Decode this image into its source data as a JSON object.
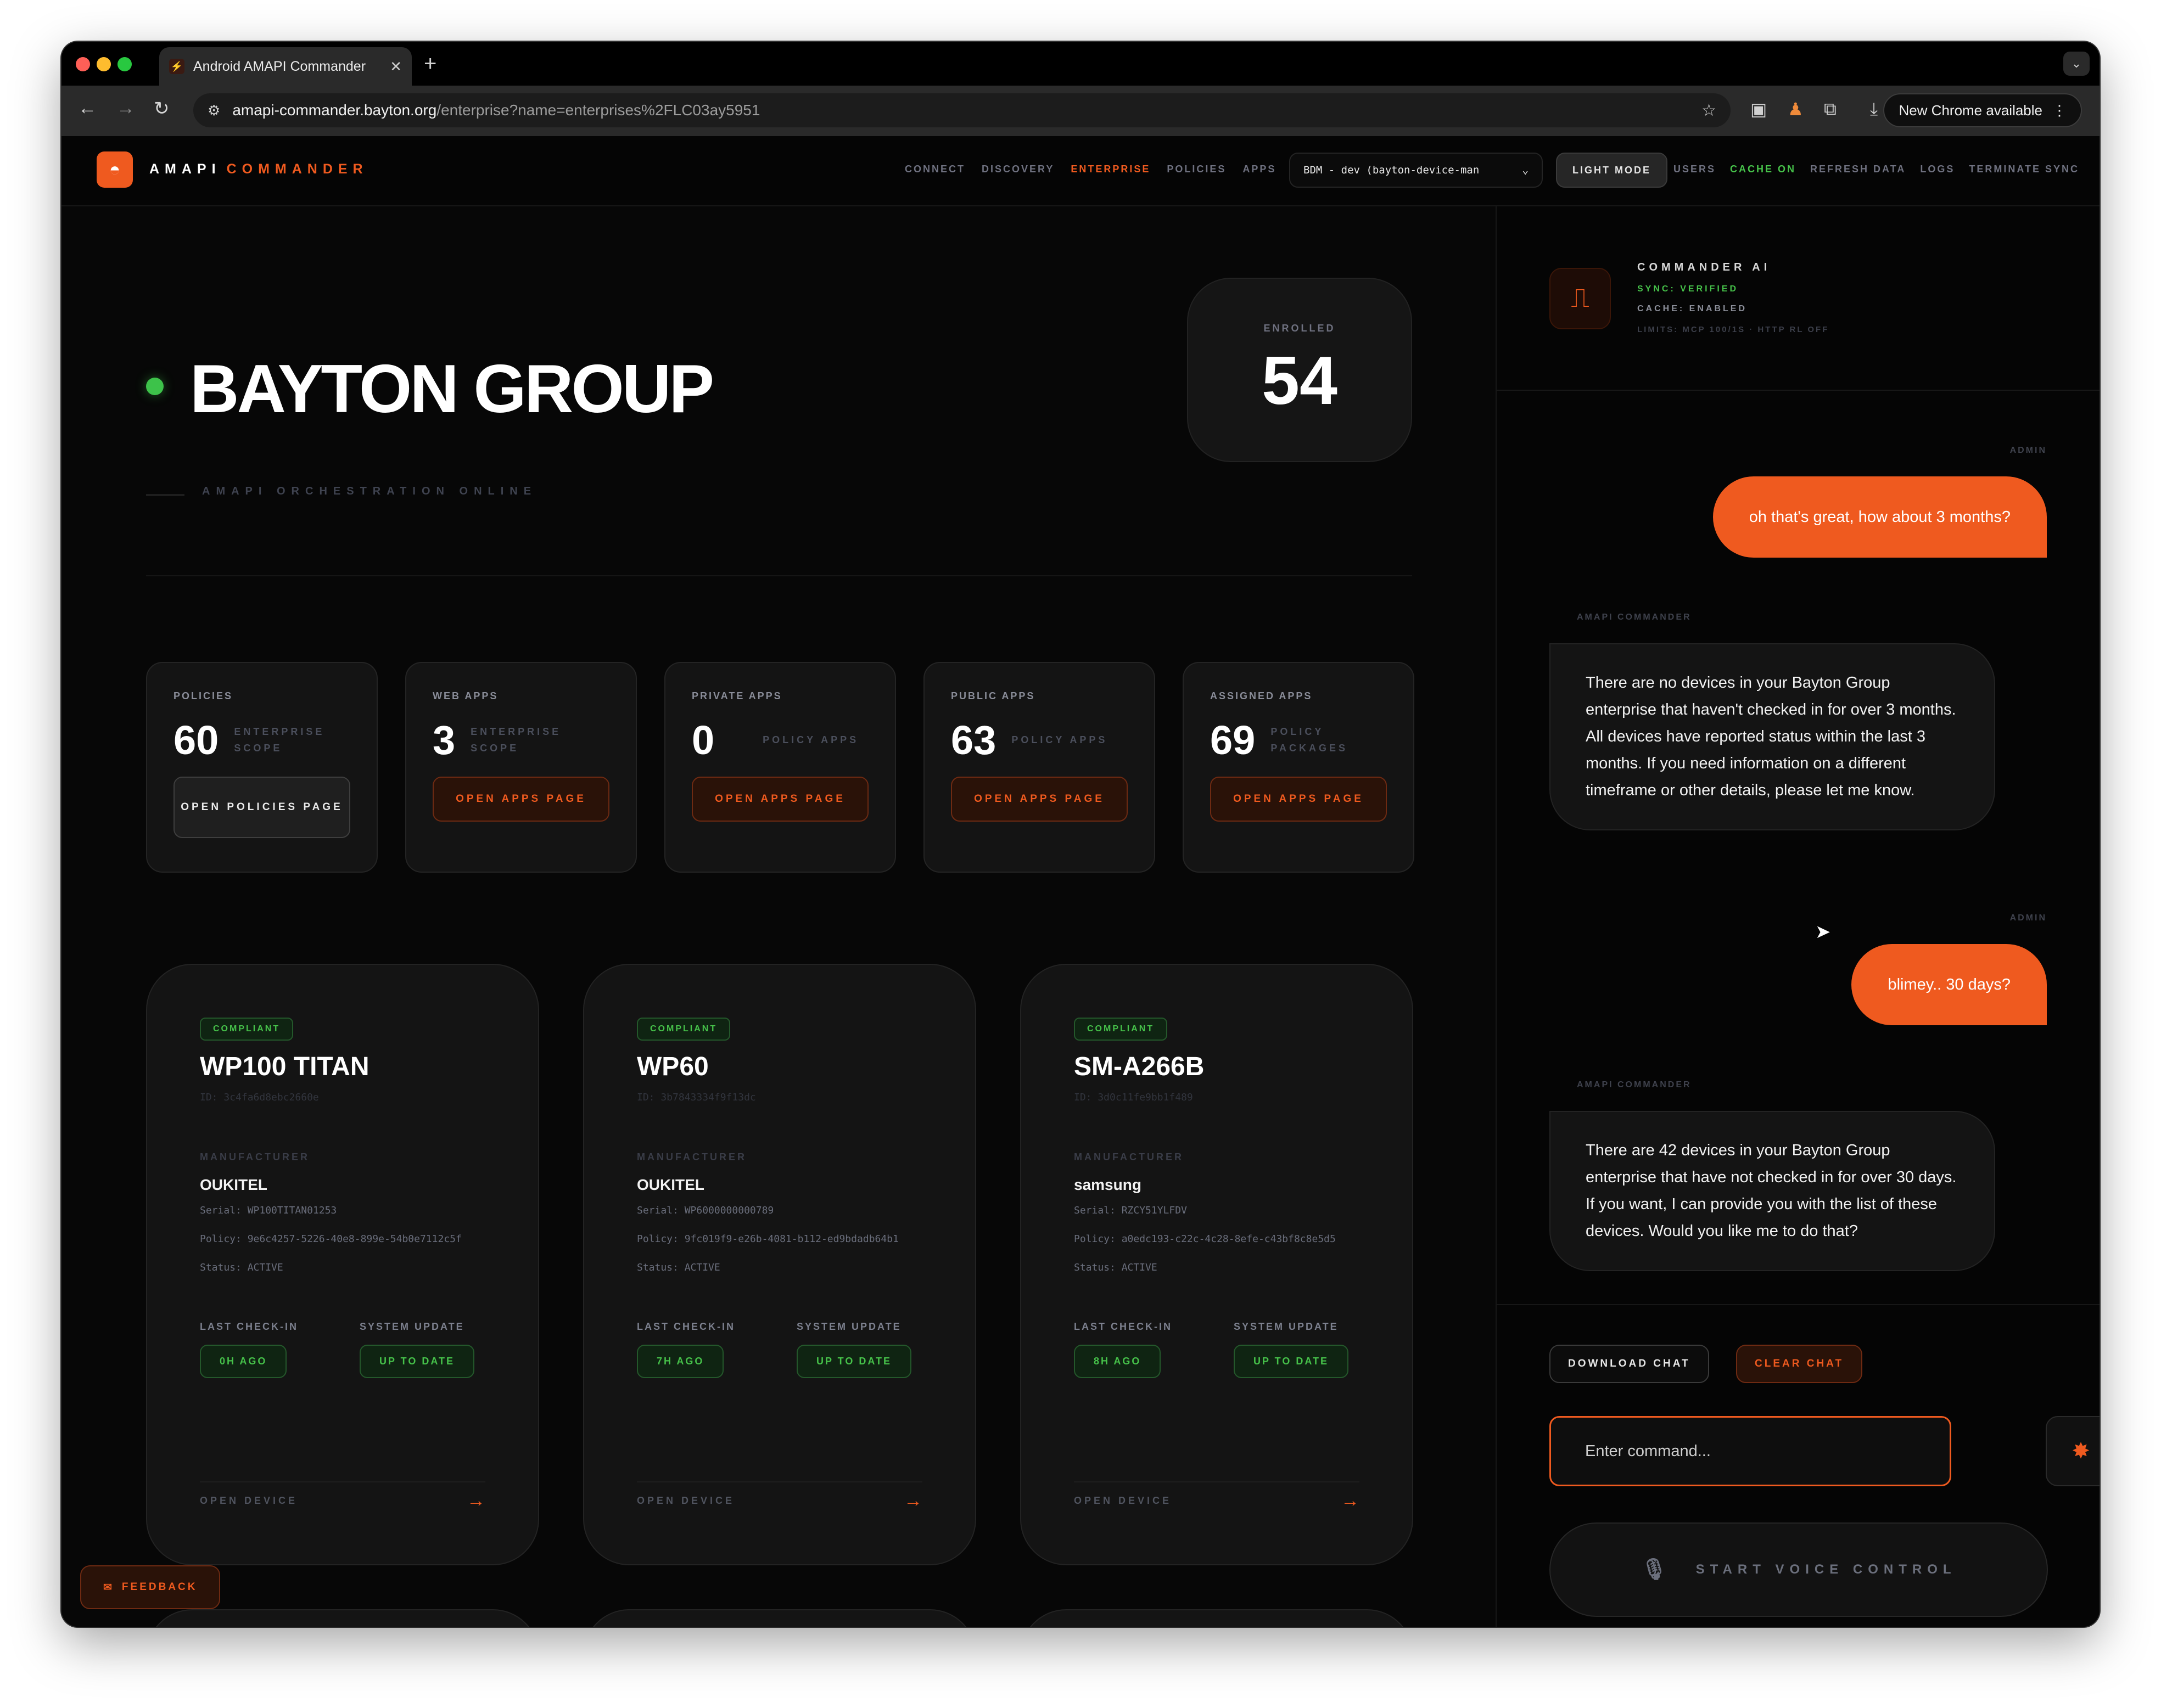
{
  "browser": {
    "tab_title": "Android AMAPI Commander",
    "url_host": "amapi-commander.bayton.org",
    "url_path": "/enterprise?name=enterprises%2FLC03ay5951",
    "new_chrome": "New Chrome available"
  },
  "header": {
    "brand_primary": "AMAPI",
    "brand_secondary": "COMMANDER",
    "nav": [
      "CONNECT",
      "DISCOVERY",
      "ENTERPRISE",
      "POLICIES",
      "APPS"
    ],
    "nav_active": "ENTERPRISE",
    "enterprise_select": "BDM - dev (bayton-device-man",
    "light_mode": "LIGHT MODE",
    "nav_right": [
      "USERS",
      "CACHE ON",
      "REFRESH DATA",
      "LOGS",
      "TERMINATE SYNC"
    ]
  },
  "hero": {
    "org_name": "BAYTON GROUP",
    "tagline": "AMAPI ORCHESTRATION ONLINE",
    "enrolled_label": "ENROLLED",
    "enrolled_value": "54"
  },
  "stats": [
    {
      "label": "POLICIES",
      "value": "60",
      "sub": "ENTERPRISE SCOPE",
      "button": "OPEN POLICIES PAGE"
    },
    {
      "label": "WEB APPS",
      "value": "3",
      "sub": "ENTERPRISE SCOPE",
      "button": "OPEN APPS PAGE"
    },
    {
      "label": "PRIVATE APPS",
      "value": "0",
      "sub": "POLICY APPS",
      "button": "OPEN APPS PAGE"
    },
    {
      "label": "PUBLIC APPS",
      "value": "63",
      "sub": "POLICY APPS",
      "button": "OPEN APPS PAGE"
    },
    {
      "label": "ASSIGNED APPS",
      "value": "69",
      "sub": "POLICY PACKAGES",
      "button": "OPEN APPS PAGE"
    }
  ],
  "device_labels": {
    "manufacturer": "MANUFACTURER",
    "last_checkin": "LAST CHECK-IN",
    "system_update": "SYSTEM UPDATE",
    "open_device": "OPEN DEVICE"
  },
  "devices": [
    {
      "badge": "COMPLIANT",
      "name": "WP100 TITAN",
      "id": "ID: 3c4fa6d8ebc2660e",
      "manufacturer": "OUKITEL",
      "serial": "Serial: WP100TITAN01253",
      "policy": "Policy: 9e6c4257-5226-40e8-899e-54b0e7112c5f",
      "status": "Status: ACTIVE",
      "checkin": "0H AGO",
      "update": "UP TO DATE"
    },
    {
      "badge": "COMPLIANT",
      "name": "WP60",
      "id": "ID: 3b7843334f9f13dc",
      "manufacturer": "OUKITEL",
      "serial": "Serial: WP6000000000789",
      "policy": "Policy: 9fc019f9-e26b-4081-b112-ed9bdadb64b1",
      "status": "Status: ACTIVE",
      "checkin": "7H AGO",
      "update": "UP TO DATE"
    },
    {
      "badge": "COMPLIANT",
      "name": "SM-A266B",
      "id": "ID: 3d0c11fe9bb1f489",
      "manufacturer": "samsung",
      "serial": "Serial: RZCY51YLFDV",
      "policy": "Policy: a0edc193-c22c-4c28-8efe-c43bf8c8e5d5",
      "status": "Status: ACTIVE",
      "checkin": "8H AGO",
      "update": "UP TO DATE"
    }
  ],
  "feedback": "FEEDBACK",
  "ai": {
    "title": "COMMANDER AI",
    "sync": "SYNC: VERIFIED",
    "cache": "CACHE: ENABLED",
    "limits": "LIMITS: MCP 100/1S · HTTP RL OFF"
  },
  "chat": [
    {
      "role": "ADMIN",
      "text": "oh that's great, how about 3 months?"
    },
    {
      "role": "AMAPI COMMANDER",
      "text": "There are no devices in your Bayton Group enterprise that haven't checked in for over 3 months. All devices have reported status within the last 3 months. If you need information on a different timeframe or other details, please let me know."
    },
    {
      "role": "ADMIN",
      "text": "blimey.. 30 days?"
    },
    {
      "role": "AMAPI COMMANDER",
      "text": "There are 42 devices in your Bayton Group enterprise that have not checked in for over 30 days. If you want, I can provide you with the list of these devices. Would you like me to do that?"
    }
  ],
  "chat_controls": {
    "download": "DOWNLOAD CHAT",
    "clear": "CLEAR CHAT",
    "input_placeholder": "Enter command...",
    "voice": "START VOICE CONTROL"
  },
  "colors": {
    "accent": "#ef5a1f",
    "success": "#46c24a",
    "background": "#070707"
  }
}
